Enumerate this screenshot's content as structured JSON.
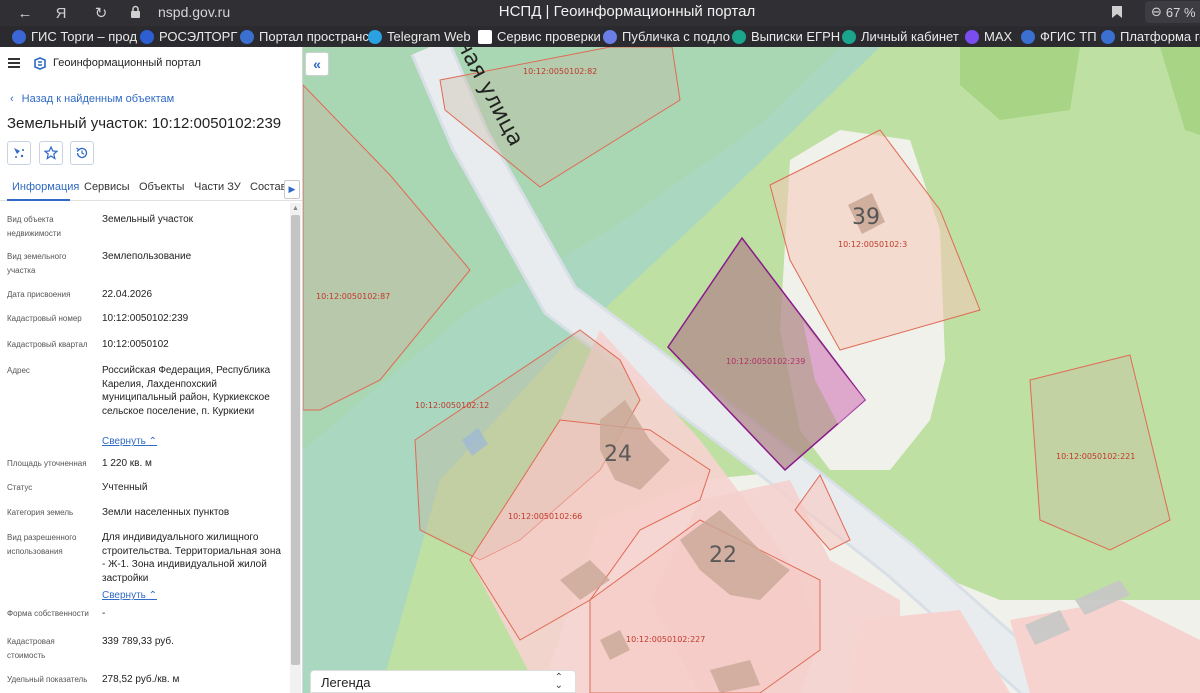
{
  "browser": {
    "url": "nspd.gov.ru",
    "title": "НСПД | Геоинформационный портал",
    "zoom": "67 %"
  },
  "bookmarks": [
    {
      "label": "ГИС Торги – прод",
      "color": "#3a66d6"
    },
    {
      "label": "РОСЭЛТОРГ",
      "color": "#2d5fd3"
    },
    {
      "label": "Портал пространс",
      "color": "#3b6fd0"
    },
    {
      "label": "Telegram Web",
      "color": "#2aa1e0"
    },
    {
      "label": "Сервис проверки",
      "color": "#ffffff"
    },
    {
      "label": "Публичка с подло",
      "color": "#6b7ee6"
    },
    {
      "label": "Выписки ЕГРН",
      "color": "#1aa58c"
    },
    {
      "label": "Личный кабинет",
      "color": "#1aa58c"
    },
    {
      "label": "MAX",
      "color": "#7a4df0"
    },
    {
      "label": "ФГИС ТП",
      "color": "#3b6fd0"
    },
    {
      "label": "Платформа гос",
      "color": "#3b6fd0"
    }
  ],
  "panel": {
    "brand": "Геоинформационный портал",
    "back_label": "Назад к найденным объектам",
    "title": "Земельный участок: 10:12:0050102:239",
    "tabs": [
      "Информация",
      "Сервисы",
      "Объекты",
      "Части ЗУ",
      "Состав"
    ],
    "active_tab": "Информация",
    "collapse_label": "Свернуть",
    "props": {
      "object_type": {
        "label": "Вид объекта недвижимости",
        "value": "Земельный участок"
      },
      "land_type": {
        "label": "Вид земельного участка",
        "value": "Землепользование"
      },
      "assign_date": {
        "label": "Дата присвоения",
        "value": "22.04.2026"
      },
      "cad_number": {
        "label": "Кадастровый номер",
        "value": "10:12:0050102:239"
      },
      "cad_quarter": {
        "label": "Кадастровый квартал",
        "value": "10:12:0050102"
      },
      "address": {
        "label": "Адрес",
        "value": "Российская Федерация, Республика Карелия, Лахденпохский муниципальный район, Куркиекское сельское поселение, п. Куркиеки"
      },
      "area": {
        "label": "Площадь уточненная",
        "value": "1 220 кв. м"
      },
      "status": {
        "label": "Статус",
        "value": "Учтенный"
      },
      "category": {
        "label": "Категория земель",
        "value": "Земли населенных пунктов"
      },
      "permitted_use": {
        "label": "Вид разрешенного использования",
        "value": "Для индивидуального жилищного строительства. Территориальная зона - Ж-1. Зона индивидуальной жилой застройки"
      },
      "ownership": {
        "label": "Форма собственности",
        "value": "-"
      },
      "cad_cost": {
        "label": "Кадастровая стоимость",
        "value": "339 789,33 руб."
      },
      "unit_cost": {
        "label": "Удельный показатель",
        "value": "278,52 руб./кв. м"
      }
    }
  },
  "map": {
    "street_label": "вная улица",
    "house_numbers": [
      "39",
      "24",
      "22"
    ],
    "parcels": [
      "10:12:0050102:82",
      "10:12:0050102:87",
      "10:12:0050102:3",
      "10:12:0050102:239",
      "10:12:0050102:12",
      "10:12:0050102:221",
      "10:12:0050102:66",
      "10:12:0050102:227"
    ],
    "legend_label": "Легенда"
  },
  "colors": {
    "accent": "#2f6ac4",
    "selected_parcel": "#8b1a8b",
    "parcel_border": "#e06a55"
  }
}
